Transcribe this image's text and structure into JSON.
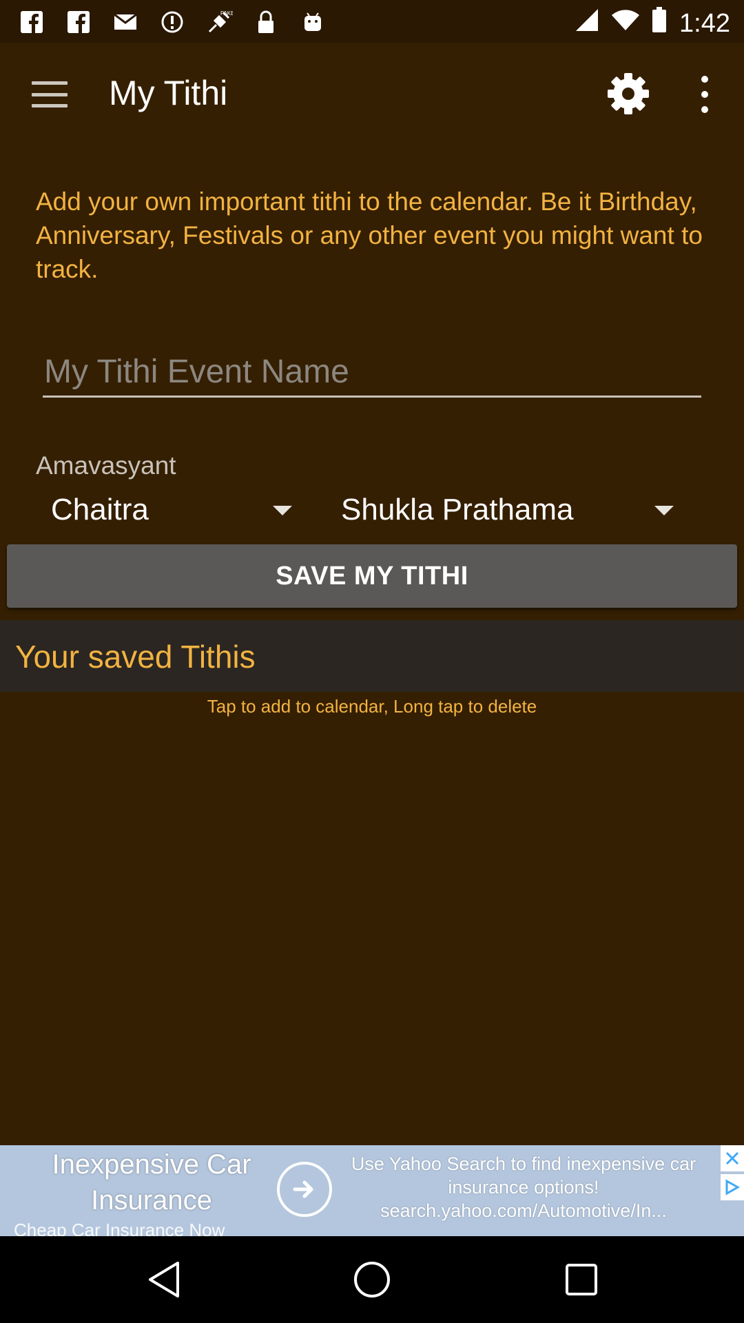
{
  "status_bar": {
    "time": "1:42",
    "left_icons": [
      "facebook-icon",
      "facebook-icon",
      "mail-icon",
      "alert-icon",
      "fake-gps-icon",
      "lock-icon",
      "android-icon"
    ],
    "right_icons": [
      "signal-icon",
      "wifi-icon",
      "battery-icon"
    ]
  },
  "app_bar": {
    "title": "My Tithi"
  },
  "intro_text": "Add your own important tithi to the calendar. Be it Birthday, Anniversary, Festivals or any other event you might want to track.",
  "event_name_input": {
    "value": "",
    "placeholder": "My Tithi Event Name"
  },
  "calendar_type_label": "Amavasyant",
  "month_spinner": {
    "selected": "Chaitra"
  },
  "tithi_spinner": {
    "selected": "Shukla Prathama"
  },
  "save_button_label": "SAVE MY TITHI",
  "saved_section": {
    "header": "Your saved Tithis",
    "hint": "Tap to add to calendar, Long tap to delete"
  },
  "ad": {
    "headline": "Inexpensive Car Insurance",
    "sub": "Cheap Car Insurance Now",
    "body": "Use Yahoo Search to find inexpensive car insurance options! search.yahoo.com/Automotive/In..."
  },
  "colors": {
    "background": "#351f02",
    "accent": "#f2b342",
    "button": "#5a5957",
    "saved_header": "#2b2621"
  }
}
